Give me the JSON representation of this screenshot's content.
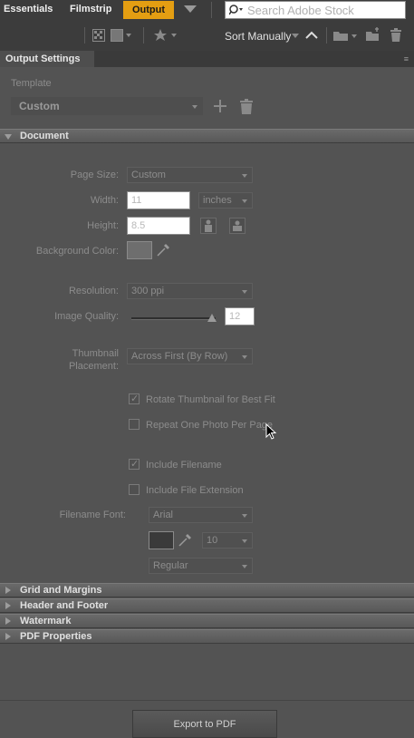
{
  "workspace": {
    "tabs": [
      "Essentials",
      "Filmstrip",
      "Output"
    ],
    "active_tab": "Output",
    "search_placeholder": "Search Adobe Stock"
  },
  "toolbar": {
    "sort_label": "Sort Manually"
  },
  "panel": {
    "title": "Output Settings",
    "template_label": "Template",
    "template_value": "Custom"
  },
  "document": {
    "section_title": "Document",
    "page_size_label": "Page Size:",
    "page_size_value": "Custom",
    "width_label": "Width:",
    "width_value": "11",
    "units_value": "inches",
    "height_label": "Height:",
    "height_value": "8.5",
    "background_label": "Background Color:",
    "resolution_label": "Resolution:",
    "resolution_value": "300 ppi",
    "quality_label": "Image Quality:",
    "quality_value": "12",
    "quality_fraction": 1.0,
    "thumb_label_1": "Thumbnail",
    "thumb_label_2": "Placement:",
    "thumb_value": "Across First (By Row)",
    "rotate_label": "Rotate Thumbnail for Best Fit",
    "rotate_checked": true,
    "repeat_label": "Repeat One Photo Per Page",
    "repeat_checked": false,
    "filename_label": "Include Filename",
    "filename_checked": true,
    "extension_label": "Include File Extension",
    "extension_checked": false,
    "font_label": "Filename Font:",
    "font_value": "Arial",
    "font_size_value": "10",
    "font_style_value": "Regular"
  },
  "sections": [
    "Grid and Margins",
    "Header and Footer",
    "Watermark",
    "PDF Properties"
  ],
  "export_button": "Export to PDF"
}
